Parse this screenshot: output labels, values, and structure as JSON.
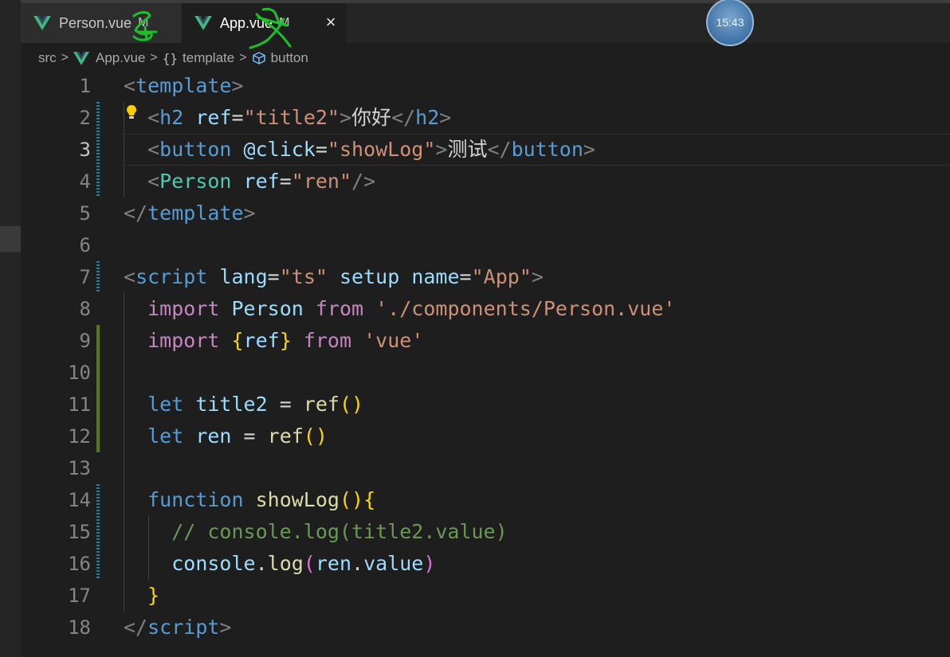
{
  "tabs": [
    {
      "label": "Person.vue",
      "status": "M",
      "active": false
    },
    {
      "label": "App.vue",
      "status": "M",
      "active": true,
      "close": "×"
    }
  ],
  "clock": "15:43",
  "breadcrumb": [
    {
      "label": "src",
      "icon": null
    },
    {
      "label": "App.vue",
      "icon": "vue-logo-icon"
    },
    {
      "label": "template",
      "icon": "braces-icon"
    },
    {
      "label": "button",
      "icon": "cube-icon"
    }
  ],
  "editor": {
    "current_line": 3,
    "line_numbers": [
      "1",
      "2",
      "3",
      "4",
      "5",
      "6",
      "7",
      "8",
      "9",
      "10",
      "11",
      "12",
      "13",
      "14",
      "15",
      "16",
      "17",
      "18"
    ],
    "lines": [
      [
        [
          "<",
          "t-punct"
        ],
        [
          "template",
          "t-tag"
        ],
        [
          ">",
          "t-punct"
        ]
      ],
      [
        [
          "  ",
          ""
        ],
        [
          "<",
          "t-punct"
        ],
        [
          "h2",
          "t-tag"
        ],
        [
          " ",
          ""
        ],
        [
          "ref",
          "t-attr"
        ],
        [
          "=",
          "t-text"
        ],
        [
          "\"title2\"",
          "t-str"
        ],
        [
          ">",
          "t-punct"
        ],
        [
          "你好",
          "t-text"
        ],
        [
          "</",
          "t-punct"
        ],
        [
          "h2",
          "t-tag"
        ],
        [
          ">",
          "t-punct"
        ]
      ],
      [
        [
          "  ",
          ""
        ],
        [
          "<",
          "t-punct"
        ],
        [
          "button",
          "t-tag"
        ],
        [
          " ",
          ""
        ],
        [
          "@click",
          "t-attr"
        ],
        [
          "=",
          "t-text"
        ],
        [
          "\"showLog\"",
          "t-str"
        ],
        [
          ">",
          "t-punct"
        ],
        [
          "测试",
          "t-text"
        ],
        [
          "</",
          "t-punct"
        ],
        [
          "button",
          "t-tag"
        ],
        [
          ">",
          "t-punct"
        ]
      ],
      [
        [
          "  ",
          ""
        ],
        [
          "<",
          "t-punct"
        ],
        [
          "Person",
          "t-comp"
        ],
        [
          " ",
          ""
        ],
        [
          "ref",
          "t-attr"
        ],
        [
          "=",
          "t-text"
        ],
        [
          "\"ren\"",
          "t-str"
        ],
        [
          "/>",
          "t-punct"
        ]
      ],
      [
        [
          "</",
          "t-punct"
        ],
        [
          "template",
          "t-tag"
        ],
        [
          ">",
          "t-punct"
        ]
      ],
      [],
      [
        [
          "<",
          "t-punct"
        ],
        [
          "script",
          "t-tag"
        ],
        [
          " ",
          ""
        ],
        [
          "lang",
          "t-attr"
        ],
        [
          "=",
          "t-text"
        ],
        [
          "\"ts\"",
          "t-str"
        ],
        [
          " ",
          ""
        ],
        [
          "setup",
          "t-attr"
        ],
        [
          " ",
          ""
        ],
        [
          "name",
          "t-attr"
        ],
        [
          "=",
          "t-text"
        ],
        [
          "\"App\"",
          "t-str"
        ],
        [
          ">",
          "t-punct"
        ]
      ],
      [
        [
          "  ",
          ""
        ],
        [
          "import",
          "t-kw"
        ],
        [
          " ",
          ""
        ],
        [
          "Person",
          "t-var"
        ],
        [
          " ",
          ""
        ],
        [
          "from",
          "t-kw"
        ],
        [
          " ",
          ""
        ],
        [
          "'./components/Person.vue'",
          "t-str"
        ]
      ],
      [
        [
          "  ",
          ""
        ],
        [
          "import",
          "t-kw"
        ],
        [
          " ",
          ""
        ],
        [
          "{",
          "t-br1"
        ],
        [
          "ref",
          "t-var"
        ],
        [
          "}",
          "t-br1"
        ],
        [
          " ",
          ""
        ],
        [
          "from",
          "t-kw"
        ],
        [
          " ",
          ""
        ],
        [
          "'vue'",
          "t-str"
        ]
      ],
      [],
      [
        [
          "  ",
          ""
        ],
        [
          "let",
          "t-decl"
        ],
        [
          " ",
          ""
        ],
        [
          "title2",
          "t-var"
        ],
        [
          " = ",
          "t-text"
        ],
        [
          "ref",
          "t-fn"
        ],
        [
          "()",
          "t-br1"
        ]
      ],
      [
        [
          "  ",
          ""
        ],
        [
          "let",
          "t-decl"
        ],
        [
          " ",
          ""
        ],
        [
          "ren",
          "t-var"
        ],
        [
          " = ",
          "t-text"
        ],
        [
          "ref",
          "t-fn"
        ],
        [
          "()",
          "t-br1"
        ]
      ],
      [],
      [
        [
          "  ",
          ""
        ],
        [
          "function",
          "t-decl"
        ],
        [
          " ",
          ""
        ],
        [
          "showLog",
          "t-fn"
        ],
        [
          "()",
          "t-br1"
        ],
        [
          "{",
          "t-br1"
        ]
      ],
      [
        [
          "    ",
          ""
        ],
        [
          "// console.log(title2.value)",
          "t-cmt"
        ]
      ],
      [
        [
          "    ",
          ""
        ],
        [
          "console",
          "t-var"
        ],
        [
          ".",
          "t-text"
        ],
        [
          "log",
          "t-fn"
        ],
        [
          "(",
          "t-br2"
        ],
        [
          "ren",
          "t-var"
        ],
        [
          ".",
          "t-text"
        ],
        [
          "value",
          "t-var"
        ],
        [
          ")",
          "t-br2"
        ]
      ],
      [
        [
          "  ",
          ""
        ],
        [
          "}",
          "t-br1"
        ]
      ],
      [
        [
          "</",
          "t-punct"
        ],
        [
          "script",
          "t-tag"
        ],
        [
          ">",
          "t-punct"
        ]
      ]
    ]
  },
  "colors": {
    "background": "#1e1e1e",
    "gutter_modified": "#1b81a8",
    "gutter_added": "#587c0c",
    "annotation_ink": "#1fbf2c"
  }
}
